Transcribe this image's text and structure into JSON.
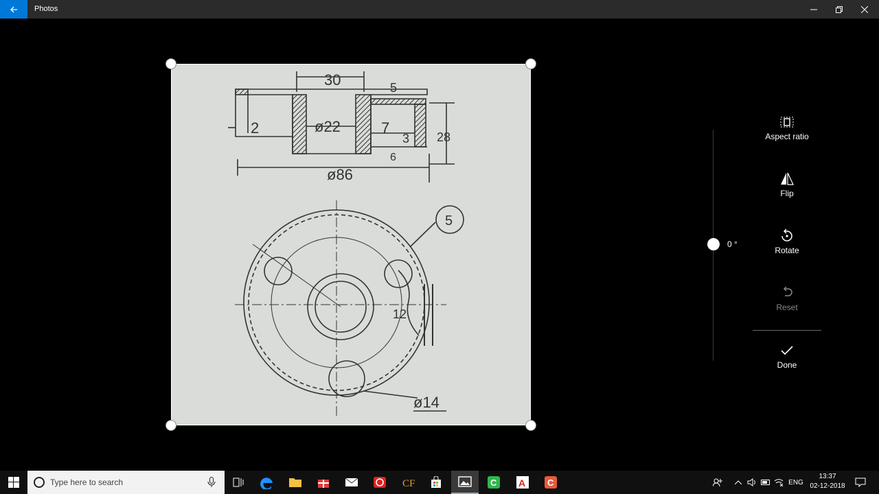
{
  "titlebar": {
    "title": "Photos",
    "back": "back-arrow",
    "minimize": "minimize",
    "maximize": "maximize",
    "close": "close"
  },
  "photo": {
    "labels": {
      "dim_30": "30",
      "dim_5": "5",
      "dim_2": "2",
      "dim_22": "ø22",
      "dim_7": "7",
      "dim_3": "3",
      "dim_6": "6",
      "dim_28": "28",
      "dim_86": "ø86",
      "balloon_5": "5",
      "dim_12": "12",
      "dim_14": "ø14"
    }
  },
  "straighten": {
    "value": "0 °"
  },
  "tools": {
    "aspect_ratio": "Aspect ratio",
    "flip": "Flip",
    "rotate": "Rotate",
    "reset": "Reset",
    "done": "Done"
  },
  "taskbar": {
    "search_placeholder": "Type here to search",
    "lang": "ENG",
    "time": "13:37",
    "date": "02-12-2018"
  },
  "colors": {
    "accent": "#0078d7",
    "titlebar": "#2b2b2b",
    "taskbar": "#101010"
  }
}
